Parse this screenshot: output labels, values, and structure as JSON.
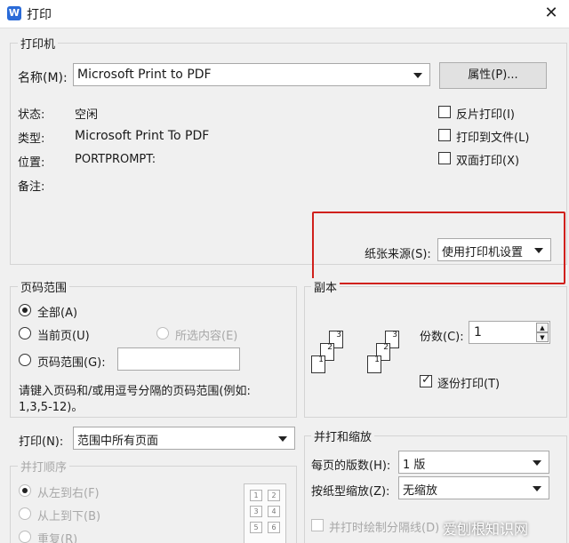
{
  "window": {
    "title": "打印",
    "app_icon_letter": "W"
  },
  "printer": {
    "group_label": "打印机",
    "name_label": "名称(M):",
    "name_value": "Microsoft Print to PDF",
    "properties_button": "属性(P)...",
    "status_label": "状态:",
    "status_value": "空闲",
    "type_label": "类型:",
    "type_value": "Microsoft Print To PDF",
    "location_label": "位置:",
    "location_value": "PORTPROMPT:",
    "comment_label": "备注:",
    "reverse_print": "反片打印(I)",
    "print_to_file": "打印到文件(L)",
    "duplex": "双面打印(X)",
    "paper_source_label": "纸张来源(S):",
    "paper_source_value": "使用打印机设置"
  },
  "page_range": {
    "group_label": "页码范围",
    "all": "全部(A)",
    "current": "当前页(U)",
    "selection": "所选内容(E)",
    "pages": "页码范围(G):",
    "pages_value": "",
    "hint": "请键入页码和/或用逗号分隔的页码范围(例如:",
    "hint2": "1,3,5-12)。"
  },
  "copies": {
    "group_label": "副本",
    "count_label": "份数(C):",
    "count_value": "1",
    "collate": "逐份打印(T)"
  },
  "print_what": {
    "label": "打印(N):",
    "value": "范围中所有页面"
  },
  "print_order": {
    "group_label": "并打顺序",
    "left_to_right": "从左到右(F)",
    "top_to_bottom": "从上到下(B)",
    "repeat": "重复(R)"
  },
  "zoom": {
    "group_label": "并打和缩放",
    "pages_per_sheet_label": "每页的版数(H):",
    "pages_per_sheet_value": "1 版",
    "scale_label": "按纸型缩放(Z):",
    "scale_value": "无缩放",
    "draw_lines": "并打时绘制分隔线(D)"
  },
  "watermark": "爱刨根知识网",
  "colors": {
    "highlight": "#d0201c",
    "background": "#f0f0f0"
  }
}
